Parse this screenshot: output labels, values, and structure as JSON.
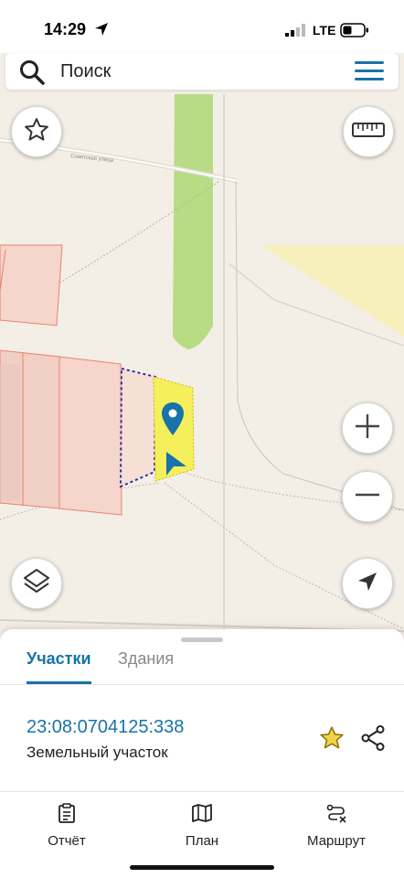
{
  "status_bar": {
    "time": "14:29",
    "network": "LTE"
  },
  "search": {
    "placeholder": "Поиск"
  },
  "map": {
    "street_label": "Советская улица"
  },
  "sheet": {
    "tabs": [
      {
        "label": "Участки",
        "active": true
      },
      {
        "label": "Здания",
        "active": false
      }
    ],
    "parcel": {
      "number": "23:08:0704125:338",
      "type": "Земельный участок"
    }
  },
  "bottom_nav": [
    {
      "label": "Отчёт",
      "icon": "report-icon"
    },
    {
      "label": "План",
      "icon": "map-icon"
    },
    {
      "label": "Маршрут",
      "icon": "route-icon"
    }
  ],
  "colors": {
    "accent": "#1773a9",
    "selected_parcel": "#f6ef5c",
    "parcel_outline": "#e9836a",
    "parcel_fill": "#f5d5cc",
    "star": "#d9b30f"
  }
}
